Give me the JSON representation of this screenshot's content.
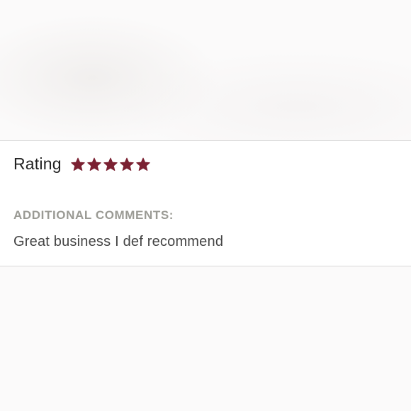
{
  "review": {
    "rating_label": "Rating",
    "rating_value": 5,
    "rating_max": 5,
    "star_color": "#7b2132",
    "star_icon": "star-icon",
    "comments_label": "ADDITIONAL COMMENTS:",
    "comments_text": "Great business I def recommend"
  }
}
